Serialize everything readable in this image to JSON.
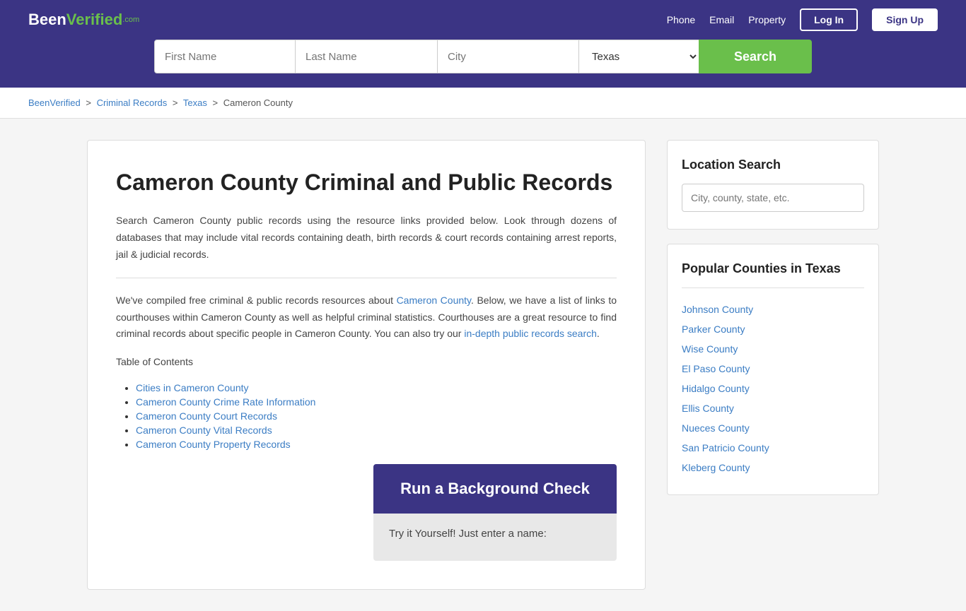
{
  "header": {
    "logo_been": "Been",
    "logo_verified": "Verified",
    "logo_com": ".com",
    "nav": {
      "phone": "Phone",
      "email": "Email",
      "property": "Property",
      "login": "Log In",
      "signup": "Sign Up"
    }
  },
  "search": {
    "first_name_placeholder": "First Name",
    "last_name_placeholder": "Last Name",
    "city_placeholder": "City",
    "state_value": "Texas",
    "button_label": "Search"
  },
  "breadcrumb": {
    "home": "BeenVerified",
    "sep1": ">",
    "crumb1": "Criminal Records",
    "sep2": ">",
    "crumb2": "Texas",
    "sep3": ">",
    "current": "Cameron County"
  },
  "main": {
    "title": "Cameron County Criminal and Public Records",
    "paragraph1": "Search Cameron County public records using the resource links provided below. Look through dozens of databases that may include vital records containing death, birth records & court records containing arrest reports, jail & judicial records.",
    "paragraph2_pre": "We've compiled free criminal & public records resources about ",
    "cameron_county_link": "Cameron County",
    "paragraph2_post": ". Below, we have a list of links to courthouses within Cameron County as well as helpful criminal statistics. Courthouses are a great resource to find criminal records about specific people in Cameron County. You can also try our ",
    "indepth_link": "in-depth public records search",
    "paragraph2_end": ".",
    "toc_title": "Table of Contents",
    "toc_items": [
      {
        "label": "Cities in Cameron County",
        "href": "#"
      },
      {
        "label": "Cameron County Crime Rate Information",
        "href": "#"
      },
      {
        "label": "Cameron County Court Records",
        "href": "#"
      },
      {
        "label": "Cameron County Vital Records",
        "href": "#"
      },
      {
        "label": "Cameron County Property Records",
        "href": "#"
      }
    ],
    "bg_check_title": "Run a Background Check",
    "bg_check_sub": "Try it Yourself! Just enter a name:"
  },
  "sidebar": {
    "location_search_title": "Location Search",
    "location_placeholder": "City, county, state, etc.",
    "popular_title": "Popular Counties in Texas",
    "counties": [
      {
        "name": "Johnson County"
      },
      {
        "name": "Parker County"
      },
      {
        "name": "Wise County"
      },
      {
        "name": "El Paso County"
      },
      {
        "name": "Hidalgo County"
      },
      {
        "name": "Ellis County"
      },
      {
        "name": "Nueces County"
      },
      {
        "name": "San Patricio County"
      },
      {
        "name": "Kleberg County"
      }
    ]
  }
}
